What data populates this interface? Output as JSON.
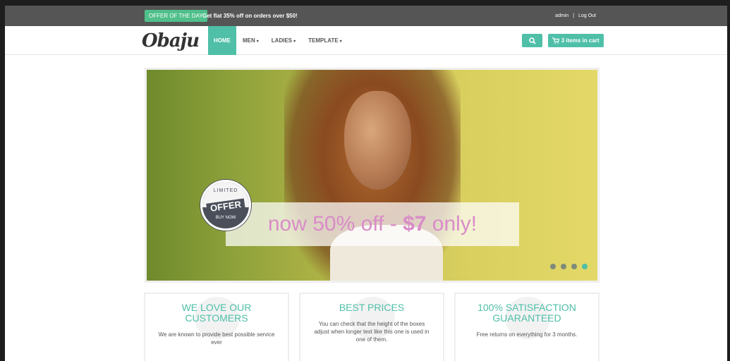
{
  "topbar": {
    "offer_badge": "OFFER OF THE DAY",
    "offer_text": "Get flat 35% off on orders over $50!",
    "account_user": "admin",
    "account_separator": "|",
    "account_logout": "Log Out"
  },
  "nav": {
    "logo": "Obaju",
    "items": [
      {
        "label": "HOME",
        "active": true
      },
      {
        "label": "MEN"
      },
      {
        "label": "LADIES"
      },
      {
        "label": "TEMPLATE"
      }
    ],
    "cart_label": "3 items in cart"
  },
  "slider": {
    "caption_prefix": "now 50% off - ",
    "caption_price": "$7",
    "caption_suffix": " only!",
    "seal_top": "LIMITED",
    "seal_main": "OFFER",
    "seal_bottom": "BUY NOW",
    "dots_count": 4,
    "active_dot": 4
  },
  "features": [
    {
      "title": "WE LOVE OUR CUSTOMERS",
      "text": "We are known to provide best possible service ever"
    },
    {
      "title": "BEST PRICES",
      "text": "You can check that the height of the boxes adjust when longer text like this one is used in one of them."
    },
    {
      "title": "100% SATISFACTION GUARANTEED",
      "text": "Free returns on everything for 3 months."
    }
  ],
  "colors": {
    "accent": "#4fbfa8",
    "offer_badge": "#4fbf8b",
    "topbar": "#555555",
    "caption": "#d98cc8"
  }
}
